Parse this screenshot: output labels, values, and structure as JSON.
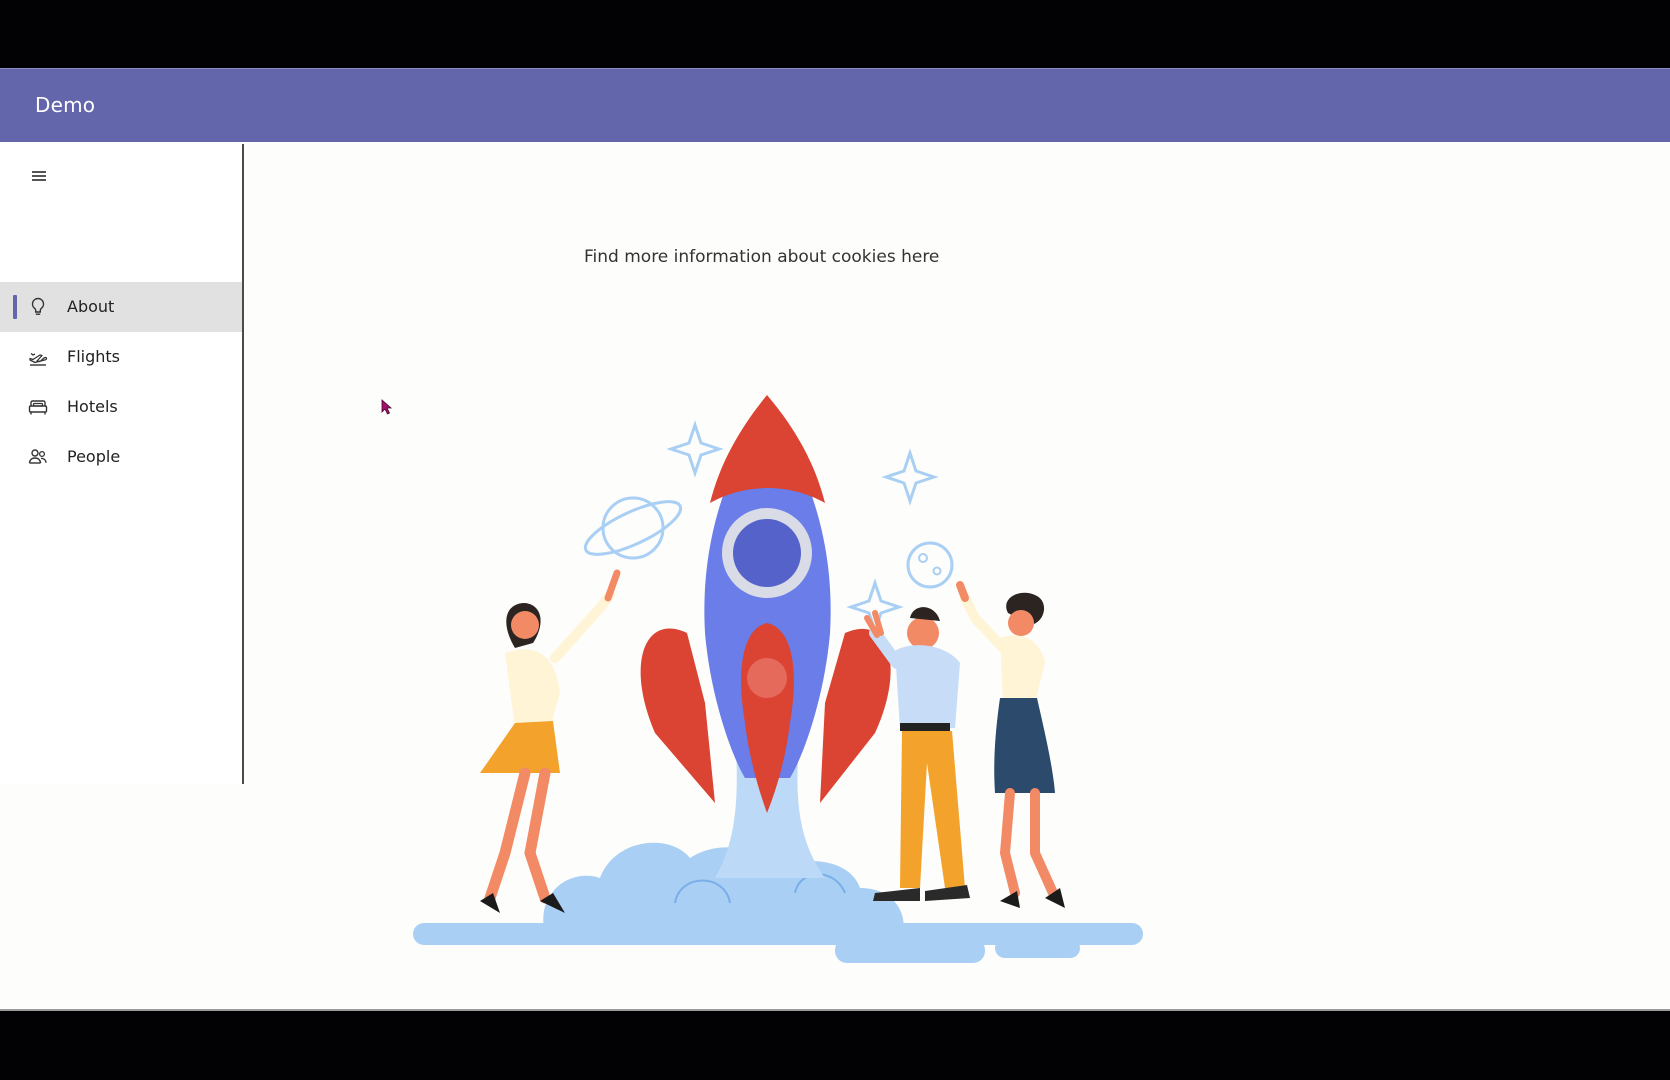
{
  "app": {
    "title": "Demo",
    "accent_color": "#6366aa"
  },
  "sidebar": {
    "menu_icon": "hamburger-icon",
    "items": [
      {
        "label": "About",
        "icon": "lightbulb-icon",
        "active": true
      },
      {
        "label": "Flights",
        "icon": "airplane-icon",
        "active": false
      },
      {
        "label": "Hotels",
        "icon": "bed-icon",
        "active": false
      },
      {
        "label": "People",
        "icon": "people-icon",
        "active": false
      }
    ]
  },
  "main": {
    "cookies_text": "Find more information about cookies here",
    "illustration": "rocket-launch-illustration"
  }
}
